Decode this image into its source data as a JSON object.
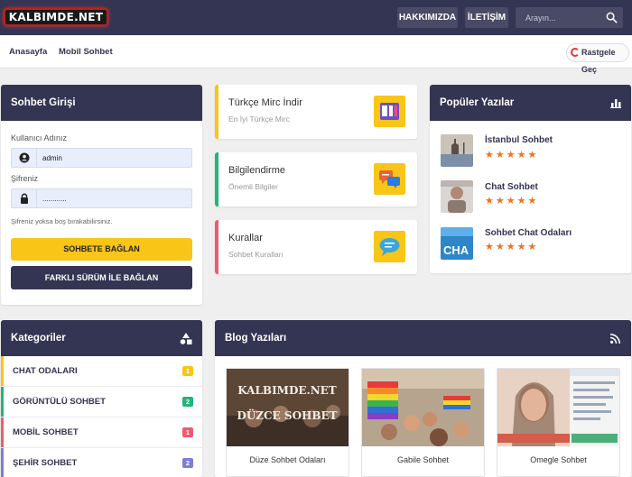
{
  "header": {
    "logo": "KALBIMDE.NET",
    "about": "HAKKIMIZDA",
    "contact": "İLETİŞİM",
    "search_placeholder": "Arayın..."
  },
  "subnav": {
    "home": "Anasayfa",
    "mobile": "Mobil Sohbet",
    "random": "Rastgele Geç"
  },
  "login": {
    "title": "Sohbet Girişi",
    "username_label": "Kullanıcı Adınız",
    "username_value": "admin",
    "password_label": "Şifreniz",
    "password_value": "............",
    "note": "Şifreniz yoksa boş bırakabilirsiniz.",
    "connect": "SOHBETE BAĞLAN",
    "alt_connect": "FARKLI SÜRÜM İLE BAĞLAN"
  },
  "cards": [
    {
      "title": "Türkçe Mirc İndir",
      "subtitle": "En İyi Türkçe Mirc",
      "color": "#f9c516"
    },
    {
      "title": "Bilgilendirme",
      "subtitle": "Önemli Bilgiler",
      "color": "#22b57a"
    },
    {
      "title": "Kurallar",
      "subtitle": "Sohbet Kuralları",
      "color": "#ef5b6e"
    }
  ],
  "popular": {
    "title": "Popüler Yazılar",
    "items": [
      {
        "title": "İstanbul Sohbet",
        "rating": 5
      },
      {
        "title": "Chat Sohbet",
        "rating": 5
      },
      {
        "title": "Sohbet Chat Odaları",
        "rating": 5
      }
    ],
    "star_glyphs": "★★★★★"
  },
  "categories": {
    "title": "Kategoriler",
    "items": [
      {
        "label": "CHAT ODALARI",
        "count": "1",
        "color": "#f9c516"
      },
      {
        "label": "GÖRÜNTÜLÜ SOHBET",
        "count": "2",
        "color": "#22b57a"
      },
      {
        "label": "MOBİL SOHBET",
        "count": "1",
        "color": "#ef5b6e"
      },
      {
        "label": "ŞEHİR SOHBET",
        "count": "2",
        "color": "#7b7fd4"
      }
    ]
  },
  "blog": {
    "title": "Blog Yazıları",
    "posts": [
      {
        "title": "Düze Sohbet Odaları",
        "image_text_1": "KALBIMDE.NET",
        "image_text_2": "DÜZCE SOHBET"
      },
      {
        "title": "Gabile Sohbet"
      },
      {
        "title": "Omegle Sohbet"
      }
    ]
  },
  "colors": {
    "primary": "#343453",
    "accent_yellow": "#f9c516",
    "star": "#f2721c"
  }
}
